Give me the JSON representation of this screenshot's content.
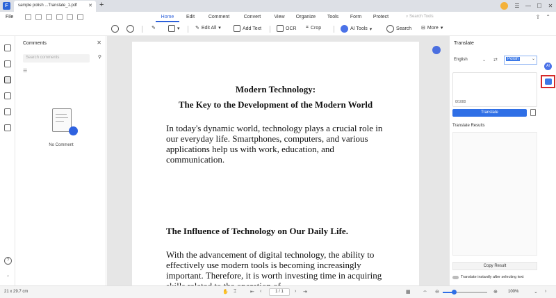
{
  "titlebar": {
    "tab_title": "sample polish ...Translate_1.pdf",
    "tab_close": "✕",
    "new_tab": "+"
  },
  "menu": {
    "file": "File",
    "tabs": [
      "Home",
      "Edit",
      "Comment",
      "Convert",
      "View",
      "Organize",
      "Tools",
      "Form",
      "Protect"
    ],
    "active_tab": "Home",
    "search_tools_placeholder": "Search Tools"
  },
  "toolbar": {
    "edit_all": "Edit All",
    "add_text": "Add Text",
    "ocr": "OCR",
    "crop": "Crop",
    "ai_tools": "AI Tools",
    "search": "Search",
    "more": "More"
  },
  "comments_panel": {
    "title": "Comments",
    "search_placeholder": "Search comments",
    "empty_text": "No Comment"
  },
  "document": {
    "title_line1": "Modern Technology:",
    "title_line2": "The Key to the Development of the Modern World",
    "para1": "In today's dynamic world, technology plays a crucial role in our everyday life. Smartphones, computers, and various applications help us with work, education, and communication.",
    "heading2": "The Influence of Technology on Our Daily Life.",
    "para2": "With the advancement of digital technology, the ability to effectively use modern tools is becoming increasingly important. Therefore, it is worth investing time in acquiring skills related to the operation of"
  },
  "translate_panel": {
    "title": "Translate",
    "source_lang": "English",
    "target_lang": "Polish",
    "char_count": "0/1000",
    "translate_button": "Translate",
    "results_label": "Translate Results",
    "copy_button": "Copy Result",
    "instant_label": "Translate instantly after selecting text"
  },
  "statusbar": {
    "page_dims": "21 x 29.7 cm",
    "page_indicator": "1 / 1",
    "zoom": "100%",
    "zoom_fraction": 0.25
  },
  "colors": {
    "accent": "#2f6fe6",
    "highlight_border": "#d42a2a",
    "app_logo": "#2b64d8"
  },
  "icons": [
    "search-icon",
    "zoom-in-icon",
    "highlighter-icon",
    "shape-icon",
    "ocr-icon",
    "crop-icon",
    "ai-icon",
    "trash-icon",
    "swap-icon",
    "filter-icon",
    "close-icon"
  ]
}
